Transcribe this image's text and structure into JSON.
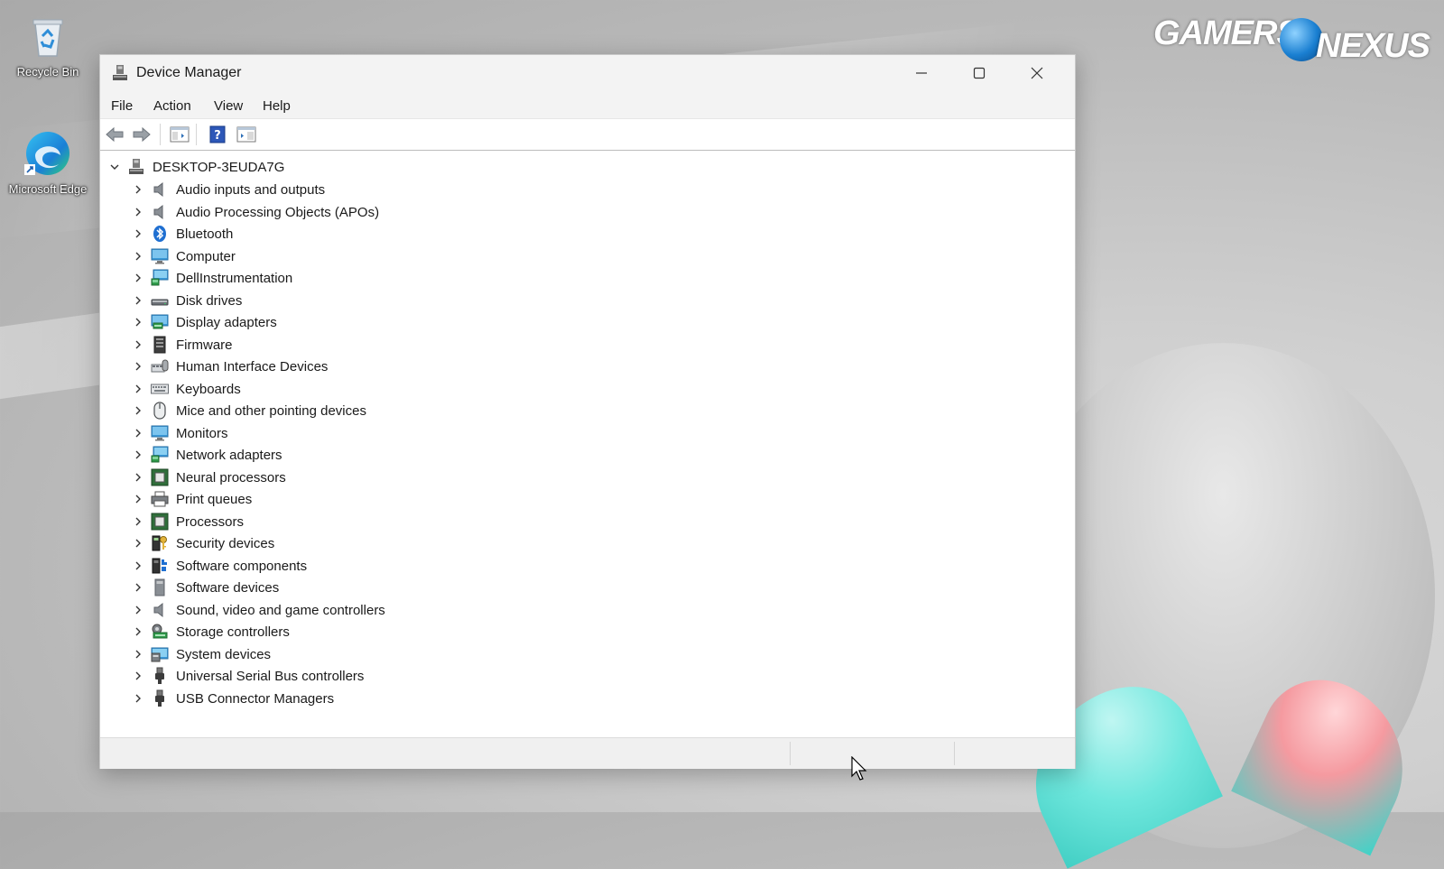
{
  "desktop": {
    "icons": [
      {
        "label": "Recycle Bin",
        "icon": "recycle-bin-icon"
      },
      {
        "label": "Microsoft Edge",
        "icon": "edge-icon"
      }
    ],
    "watermark": {
      "part1": "GAMERS",
      "part2": "NEXUS"
    }
  },
  "window": {
    "title": "Device Manager",
    "controls": {
      "minimize": "minimize-icon",
      "maximize": "maximize-icon",
      "close": "close-icon"
    }
  },
  "menu": [
    {
      "label": "File"
    },
    {
      "label": "Action"
    },
    {
      "label": "View"
    },
    {
      "label": "Help"
    }
  ],
  "toolbar": [
    "back-arrow-icon",
    "forward-arrow-icon",
    "show-hide-console-tree-icon",
    "help-icon",
    "properties-pane-icon"
  ],
  "tree": {
    "root": {
      "label": "DESKTOP-3EUDA7G",
      "expanded": true,
      "icon": "computer-node-icon"
    },
    "items": [
      {
        "label": "Audio inputs and outputs",
        "icon": "speaker-icon"
      },
      {
        "label": "Audio Processing Objects (APOs)",
        "icon": "speaker-icon"
      },
      {
        "label": "Bluetooth",
        "icon": "bluetooth-icon"
      },
      {
        "label": "Computer",
        "icon": "monitor-icon"
      },
      {
        "label": "DellInstrumentation",
        "icon": "network-monitor-icon"
      },
      {
        "label": "Disk drives",
        "icon": "disk-drive-icon"
      },
      {
        "label": "Display adapters",
        "icon": "display-adapter-icon"
      },
      {
        "label": "Firmware",
        "icon": "firmware-icon"
      },
      {
        "label": "Human Interface Devices",
        "icon": "hid-icon"
      },
      {
        "label": "Keyboards",
        "icon": "keyboard-icon"
      },
      {
        "label": "Mice and other pointing devices",
        "icon": "mouse-icon"
      },
      {
        "label": "Monitors",
        "icon": "monitor-icon"
      },
      {
        "label": "Network adapters",
        "icon": "network-monitor-icon"
      },
      {
        "label": "Neural processors",
        "icon": "chip-icon"
      },
      {
        "label": "Print queues",
        "icon": "printer-icon"
      },
      {
        "label": "Processors",
        "icon": "chip-icon"
      },
      {
        "label": "Security devices",
        "icon": "security-key-icon"
      },
      {
        "label": "Software components",
        "icon": "software-component-icon"
      },
      {
        "label": "Software devices",
        "icon": "software-device-icon"
      },
      {
        "label": "Sound, video and game controllers",
        "icon": "speaker-icon"
      },
      {
        "label": "Storage controllers",
        "icon": "storage-controller-icon"
      },
      {
        "label": "System devices",
        "icon": "system-folder-icon"
      },
      {
        "label": "Universal Serial Bus controllers",
        "icon": "usb-icon"
      },
      {
        "label": "USB Connector Managers",
        "icon": "usb-icon"
      }
    ]
  },
  "colors": {
    "accent": "#0078d4",
    "chip": "#2f6e3a",
    "monitor": "#3a9ad9"
  }
}
